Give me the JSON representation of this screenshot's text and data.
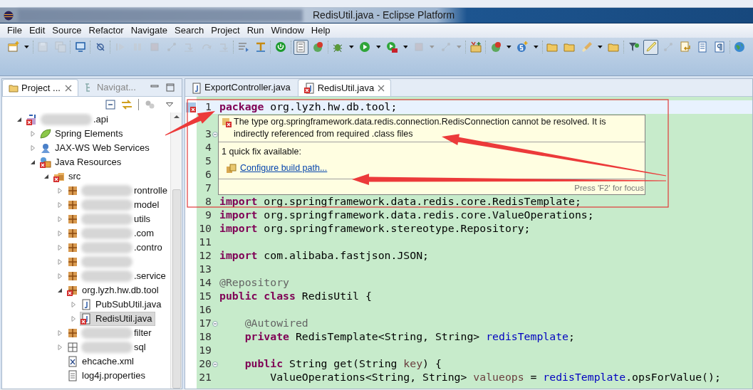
{
  "window": {
    "title": "RedisUtil.java - Eclipse Platform"
  },
  "menu": [
    "File",
    "Edit",
    "Source",
    "Refactor",
    "Navigate",
    "Search",
    "Project",
    "Run",
    "Window",
    "Help"
  ],
  "toolbar": [
    {
      "kind": "new-file",
      "disabled": false
    },
    {
      "kind": "dropdown",
      "disabled": false
    },
    {
      "kind": "separator"
    },
    {
      "kind": "disk",
      "disabled": true
    },
    {
      "kind": "disks",
      "disabled": true
    },
    {
      "kind": "separator"
    },
    {
      "kind": "monitor",
      "disabled": false
    },
    {
      "kind": "separator"
    },
    {
      "kind": "no-break",
      "disabled": false
    },
    {
      "kind": "separator"
    },
    {
      "kind": "resume",
      "disabled": true
    },
    {
      "kind": "pause",
      "disabled": true
    },
    {
      "kind": "stop",
      "disabled": true
    },
    {
      "kind": "nodes",
      "disabled": true
    },
    {
      "kind": "step",
      "disabled": true
    },
    {
      "kind": "curve",
      "disabled": true
    },
    {
      "kind": "step",
      "disabled": true
    },
    {
      "kind": "separator"
    },
    {
      "kind": "lines",
      "disabled": false
    },
    {
      "kind": "swap",
      "disabled": false
    },
    {
      "kind": "separator"
    },
    {
      "kind": "power",
      "disabled": false
    },
    {
      "kind": "separator"
    },
    {
      "kind": "numbers",
      "disabled": false,
      "pressed": true
    },
    {
      "kind": "globe-badge",
      "disabled": false
    },
    {
      "kind": "separator"
    },
    {
      "kind": "bug",
      "disabled": false
    },
    {
      "kind": "dropdown",
      "disabled": false
    },
    {
      "kind": "play",
      "disabled": false
    },
    {
      "kind": "dropdown",
      "disabled": false
    },
    {
      "kind": "play-case",
      "disabled": false
    },
    {
      "kind": "dropdown",
      "disabled": false
    },
    {
      "kind": "stop",
      "disabled": true
    },
    {
      "kind": "dropdown",
      "disabled": true
    },
    {
      "kind": "nodes",
      "disabled": true
    },
    {
      "kind": "dropdown",
      "disabled": true
    },
    {
      "kind": "separator"
    },
    {
      "kind": "folder-plus",
      "disabled": false
    },
    {
      "kind": "separator"
    },
    {
      "kind": "globe-badge",
      "disabled": false
    },
    {
      "kind": "dropdown",
      "disabled": false
    },
    {
      "kind": "s-plus",
      "disabled": false
    },
    {
      "kind": "dropdown",
      "disabled": false
    },
    {
      "kind": "separator"
    },
    {
      "kind": "folder",
      "disabled": false
    },
    {
      "kind": "folder",
      "disabled": false
    },
    {
      "kind": "brush",
      "disabled": false
    },
    {
      "kind": "dropdown",
      "disabled": false
    },
    {
      "kind": "folder",
      "disabled": false
    },
    {
      "kind": "separator"
    },
    {
      "kind": "filter",
      "disabled": false
    },
    {
      "kind": "pen",
      "disabled": false,
      "pressed": true
    },
    {
      "kind": "nodes",
      "disabled": true
    },
    {
      "kind": "page-arrow",
      "disabled": false
    },
    {
      "kind": "page",
      "disabled": false
    },
    {
      "kind": "pilcrow",
      "disabled": false
    },
    {
      "kind": "separator"
    },
    {
      "kind": "globe",
      "disabled": false
    }
  ],
  "explorer": {
    "tabs": [
      {
        "label": "Project ...",
        "selected": true
      },
      {
        "label": "Navigat...",
        "selected": false
      }
    ],
    "tree": [
      {
        "label": ".api",
        "kind": "project",
        "expanded": true,
        "selected": false,
        "error": true,
        "blurred": true,
        "children": [
          {
            "label": "Spring Elements",
            "kind": "leaf",
            "expanded": false,
            "selected": false,
            "error": false,
            "blurred": false
          },
          {
            "label": "JAX-WS Web Services",
            "kind": "service",
            "expanded": false,
            "selected": false,
            "error": false,
            "blurred": false
          },
          {
            "label": "Java Resources",
            "kind": "resources",
            "expanded": true,
            "selected": false,
            "error": true,
            "blurred": false,
            "children": [
              {
                "label": "src",
                "kind": "source",
                "expanded": true,
                "selected": false,
                "error": true,
                "blurred": false,
                "children": [
                  {
                    "label": "rontrolle",
                    "kind": "package",
                    "expanded": false,
                    "selected": false,
                    "error": false,
                    "blurred": true
                  },
                  {
                    "label": "model",
                    "kind": "package",
                    "expanded": false,
                    "selected": false,
                    "error": false,
                    "blurred": true
                  },
                  {
                    "label": "utils",
                    "kind": "package",
                    "expanded": false,
                    "selected": false,
                    "error": false,
                    "blurred": true
                  },
                  {
                    "label": ".com",
                    "kind": "package",
                    "expanded": false,
                    "selected": false,
                    "error": false,
                    "blurred": true
                  },
                  {
                    "label": ".contro",
                    "kind": "package",
                    "expanded": false,
                    "selected": false,
                    "error": false,
                    "blurred": true
                  },
                  {
                    "kind": "package",
                    "expanded": false,
                    "selected": false,
                    "error": false,
                    "blurred": true
                  },
                  {
                    "label": ".service",
                    "kind": "package",
                    "expanded": false,
                    "selected": false,
                    "error": false,
                    "blurred": true
                  },
                  {
                    "label": "org.lyzh.hw.db.tool",
                    "kind": "package",
                    "expanded": true,
                    "selected": false,
                    "error": true,
                    "blurred": false,
                    "children": [
                      {
                        "label": "PubSubUtil.java",
                        "kind": "java",
                        "expanded": false,
                        "selected": false,
                        "error": false,
                        "blurred": false
                      },
                      {
                        "label": "RedisUtil.java",
                        "kind": "java",
                        "expanded": false,
                        "selected": true,
                        "error": true,
                        "blurred": false
                      }
                    ]
                  },
                  {
                    "label": "filter",
                    "kind": "package",
                    "expanded": false,
                    "selected": false,
                    "error": false,
                    "blurred": true
                  },
                  {
                    "label": "sql",
                    "kind": "empty-package",
                    "expanded": false,
                    "selected": false,
                    "error": false,
                    "blurred": true
                  },
                  {
                    "label": "ehcache.xml",
                    "kind": "xml",
                    "selected": false,
                    "error": false,
                    "blurred": false
                  },
                  {
                    "label": "log4j.properties",
                    "kind": "text",
                    "selected": false,
                    "error": false,
                    "blurred": false
                  }
                ]
              }
            ]
          }
        ]
      }
    ]
  },
  "editor": {
    "tabs": [
      {
        "label": "ExportController.java",
        "selected": false,
        "error": false
      },
      {
        "label": "RedisUtil.java",
        "selected": true,
        "error": true
      }
    ],
    "lines": [
      {
        "number": "1",
        "current": true,
        "error": true,
        "segments": [
          {
            "text": "package",
            "kind": "kw"
          },
          {
            "text": " org.lyzh.hw.db.tool;",
            "kind": "plain"
          }
        ]
      },
      {
        "current": false,
        "error": false
      },
      {
        "number": "3",
        "current": false,
        "error": false,
        "fold_marker": true
      },
      {
        "number": "4",
        "current": false,
        "error": false
      },
      {
        "number": "5",
        "current": false,
        "error": false
      },
      {
        "number": "6",
        "current": false,
        "error": false
      },
      {
        "number": "7",
        "current": false,
        "error": false
      },
      {
        "number": "8",
        "current": false,
        "error": false,
        "segments": [
          {
            "text": "import",
            "kind": "kw"
          },
          {
            "text": " org.springframework.data.redis.core.RedisTemplate;",
            "kind": "plain"
          }
        ]
      },
      {
        "number": "9",
        "current": false,
        "error": false,
        "segments": [
          {
            "text": "import",
            "kind": "kw"
          },
          {
            "text": " org.springframework.data.redis.core.ValueOperations;",
            "kind": "plain"
          }
        ]
      },
      {
        "number": "10",
        "current": false,
        "error": false,
        "segments": [
          {
            "text": "import",
            "kind": "kw"
          },
          {
            "text": " org.springframework.stereotype.Repository;",
            "kind": "plain"
          }
        ]
      },
      {
        "number": "11",
        "current": false,
        "error": false
      },
      {
        "number": "12",
        "current": false,
        "error": false,
        "segments": [
          {
            "text": "import",
            "kind": "kw"
          },
          {
            "text": " com.alibaba.fastjson.JSON;",
            "kind": "plain"
          }
        ]
      },
      {
        "number": "13",
        "current": false,
        "error": false
      },
      {
        "number": "14",
        "current": false,
        "error": false,
        "segments": [
          {
            "text": "@Repository",
            "kind": "ann"
          }
        ]
      },
      {
        "number": "15",
        "current": false,
        "error": false,
        "segments": [
          {
            "text": "public",
            "kind": "kw"
          },
          {
            "text": " class",
            "kind": "kw"
          },
          {
            "text": " RedisUtil {",
            "kind": "plain"
          }
        ]
      },
      {
        "number": "16",
        "current": false,
        "error": false
      },
      {
        "number": "17",
        "current": false,
        "error": false,
        "fold_marker": true,
        "segments": [
          {
            "text": "    @Autowired",
            "kind": "ann"
          }
        ]
      },
      {
        "number": "18",
        "current": false,
        "error": false,
        "segments": [
          {
            "text": "    private",
            "kind": "kw"
          },
          {
            "text": " RedisTemplate<String, String> ",
            "kind": "plain"
          },
          {
            "text": "redisTemplate",
            "kind": "field"
          },
          {
            "text": ";",
            "kind": "plain"
          }
        ]
      },
      {
        "number": "19",
        "current": false,
        "error": false
      },
      {
        "number": "20",
        "current": false,
        "error": false,
        "fold_marker": true,
        "segments": [
          {
            "text": "    public",
            "kind": "kw"
          },
          {
            "text": " String get(String ",
            "kind": "plain"
          },
          {
            "text": "key",
            "kind": "local"
          },
          {
            "text": ") {",
            "kind": "plain"
          }
        ]
      },
      {
        "number": "21",
        "current": false,
        "error": false,
        "segments": [
          {
            "text": "        ValueOperations<String, String> ",
            "kind": "plain"
          },
          {
            "text": "valueops",
            "kind": "local"
          },
          {
            "text": " = ",
            "kind": "plain"
          },
          {
            "text": "redisTemplate",
            "kind": "field"
          },
          {
            "text": ".opsForValue();",
            "kind": "plain"
          }
        ]
      }
    ],
    "hover": {
      "message": "The type org.springframework.data.redis.connection.RedisConnection cannot be resolved. It is indirectly referenced from required .class files",
      "fix_count": "1 quick fix available:",
      "fixes": [
        "Configure build path..."
      ],
      "footer": "Press 'F2' for focus"
    }
  }
}
